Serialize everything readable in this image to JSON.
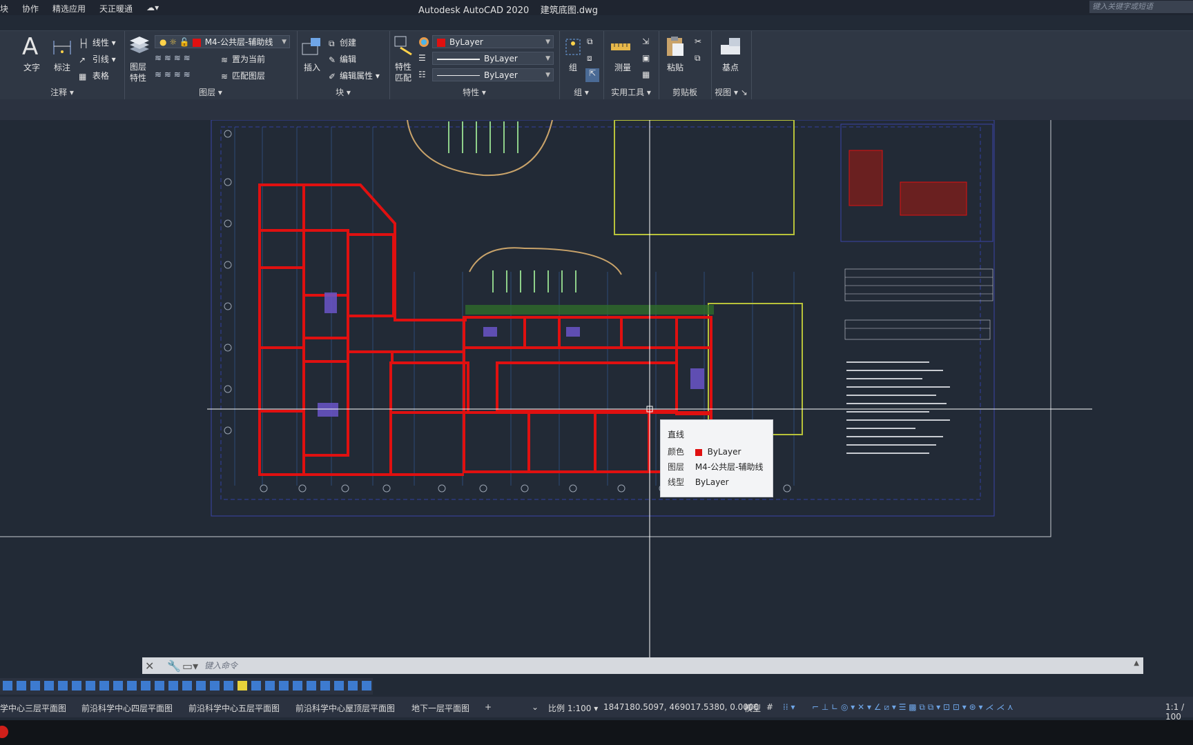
{
  "app_title": "Autodesk AutoCAD 2020",
  "file_name": "建筑底图.dwg",
  "menu": [
    "块",
    "协作",
    "精选应用",
    "天正暖通"
  ],
  "search_placeholder": "键入关键字或短语",
  "ribbon": {
    "annotate": {
      "title": "注释",
      "text": "文字",
      "dimension": "标注",
      "linear": "线性",
      "leader": "引线",
      "table": "表格"
    },
    "layers": {
      "title": "图层",
      "layer_props": "图层\n特性",
      "current_layer": "M4-公共层-辅助线",
      "set_current": "置为当前",
      "match_layer": "匹配图层"
    },
    "block": {
      "title": "块",
      "insert": "插入",
      "create": "创建",
      "edit": "编辑",
      "edit_attr": "编辑属性"
    },
    "properties": {
      "title": "特性",
      "match": "特性\n匹配",
      "color": "ByLayer",
      "linetype": "ByLayer",
      "lineweight": "ByLayer"
    },
    "groups": {
      "title": "组",
      "group": "组"
    },
    "utilities": {
      "title": "实用工具",
      "measure": "测量"
    },
    "clipboard": {
      "title": "剪贴板",
      "paste": "粘贴"
    },
    "view": {
      "title": "视图",
      "base": "基点"
    }
  },
  "tooltip": {
    "title": "直线",
    "color_label": "颜色",
    "color_value": "ByLayer",
    "layer_label": "图层",
    "layer_value": "M4-公共层-辅助线",
    "linetype_label": "线型",
    "linetype_value": "ByLayer",
    "swatch": "#e01010"
  },
  "command_prompt": "键入命令",
  "layout_tabs": [
    "学中心三层平面图",
    "前沿科学中心四层平面图",
    "前沿科学中心五层平面图",
    "前沿科学中心屋顶层平面图",
    "地下一层平面图"
  ],
  "status": {
    "scale": "比例 1:100",
    "coords": "1847180.5097, 469017.5380, 0.0000",
    "model": "模型",
    "zoom": "1:1 / 100"
  },
  "colors": {
    "accent_red": "#e01010",
    "bg": "#222a36",
    "ribbon": "#2f3744"
  }
}
